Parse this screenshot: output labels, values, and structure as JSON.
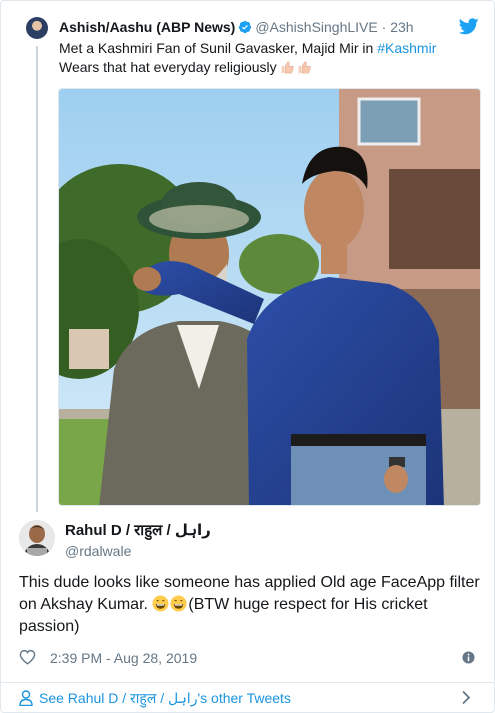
{
  "quoted_tweet": {
    "author_name": "Ashish/Aashu (ABP News)",
    "author_handle": "@AshishSinghLIVE",
    "separator": "·",
    "time": "23h",
    "text_line1": "Met a Kashmiri Fan of Sunil Gavasker, Majid Mir in ",
    "hashtag": "#Kashmir",
    "text_line2": "Wears that hat everyday religiously",
    "emojis": [
      "thumbs-up-emoji",
      "thumbs-up-emoji"
    ],
    "has_photo": true
  },
  "tweet": {
    "author_name": "Rahul D / राहुल / راہل",
    "author_handle": "@rdalwale",
    "text_part1": "This dude looks like someone has applied Old age FaceApp filter on Akshay Kumar. ",
    "emojis": [
      "grinning-face-emoji",
      "grinning-face-emoji"
    ],
    "text_part2": "(BTW huge respect for His cricket passion)",
    "timestamp": "2:39 PM - Aug 28, 2019"
  },
  "footer": {
    "link_text": "See Rahul D / राहुल / راہل's other Tweets"
  },
  "colors": {
    "link": "#1b95e0",
    "secondary_text": "#657786",
    "border": "#e1e8ed",
    "twitter_blue": "#1da1f2"
  }
}
